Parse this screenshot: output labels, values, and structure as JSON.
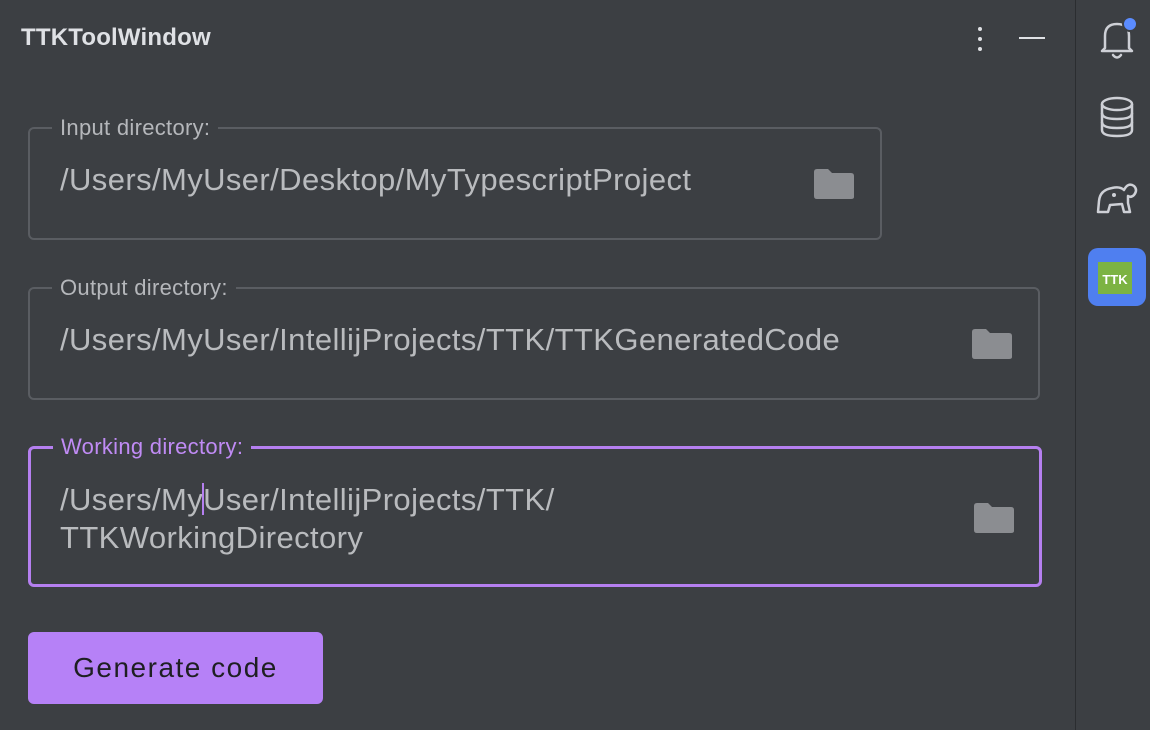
{
  "window": {
    "title": "TTKToolWindow"
  },
  "header": {
    "more_icon": "more-vertical-icon",
    "minimize_icon": "minimize-icon"
  },
  "fields": {
    "input": {
      "label": "Input directory:",
      "value": "/Users/MyUser/Desktop/MyTypescriptProject",
      "icon": "folder-icon"
    },
    "output": {
      "label": "Output directory:",
      "value": "/Users/MyUser/IntellijProjects/TTK/TTKGeneratedCode",
      "icon": "folder-icon"
    },
    "working": {
      "label": "Working directory:",
      "value": "/Users/MyUser/IntellijProjects/TTK/TTKWorkingDirectory",
      "line1_before_caret": "/Users/My",
      "line1_after_caret": "User/IntellijProjects/TTK/",
      "line2": "TTKWorkingDirectory",
      "icon": "folder-icon",
      "focused": true
    }
  },
  "actions": {
    "generate_label": "Generate code"
  },
  "right_toolbar": {
    "items": [
      {
        "name": "notifications",
        "icon": "bell-icon",
        "has_badge": true
      },
      {
        "name": "database",
        "icon": "database-icon"
      },
      {
        "name": "gradle",
        "icon": "gradle-elephant-icon"
      },
      {
        "name": "ttk",
        "icon": "ttk-icon",
        "text": "TTK",
        "active": true
      }
    ]
  },
  "colors": {
    "background": "#3c3f43",
    "accent": "#b681f7",
    "focus_border": "#b57ff0",
    "active_tool": "#4f7ff0",
    "notification_badge": "#5b8cff",
    "ttk_icon": "#7cb342"
  }
}
